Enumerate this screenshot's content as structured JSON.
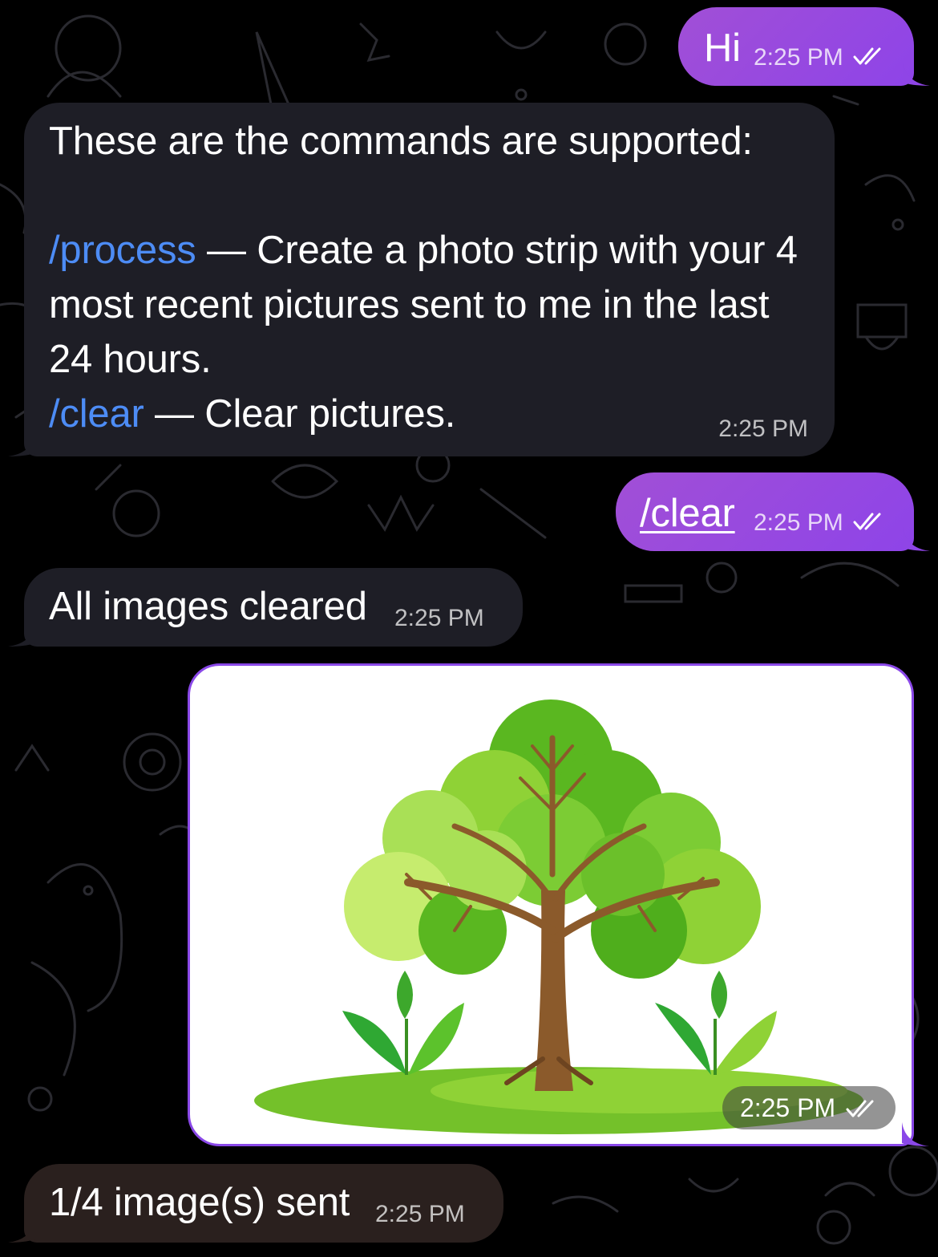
{
  "messages": [
    {
      "id": "m1",
      "direction": "outgoing",
      "text": "Hi",
      "time": "2:25 PM",
      "status": "read-double-check"
    },
    {
      "id": "m2",
      "direction": "incoming",
      "intro": "These are the commands are supported:",
      "commands": [
        {
          "command": "/process",
          "description": "Create a photo strip with your 4 most recent pictures sent to me in the last 24 hours."
        },
        {
          "command": "/clear",
          "description": "Clear pictures."
        }
      ],
      "separator": "—",
      "time": "2:25 PM"
    },
    {
      "id": "m3",
      "direction": "outgoing",
      "text": "/clear",
      "time": "2:25 PM",
      "status": "read-double-check"
    },
    {
      "id": "m4",
      "direction": "incoming",
      "text": "All images cleared",
      "time": "2:25 PM"
    },
    {
      "id": "m5",
      "direction": "outgoing",
      "type": "photo",
      "image": "tree-illustration",
      "time": "2:25 PM",
      "status": "read-double-check"
    },
    {
      "id": "m6",
      "direction": "incoming",
      "text": "1/4 image(s) sent",
      "time": "2:25 PM"
    }
  ],
  "colors": {
    "outgoing": "#9b4fe0",
    "incoming": "#1e1e26",
    "command_link": "#4d8cf5",
    "background": "#000000"
  }
}
